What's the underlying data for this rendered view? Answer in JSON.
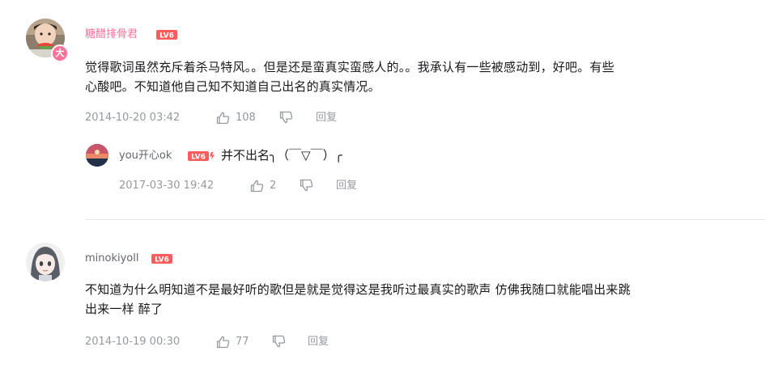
{
  "comments": [
    {
      "username": "糖醋排骨君",
      "level": "LV6",
      "avatar_badge": "大",
      "text_line1": "觉得歌词虽然充斥着杀马特风。。但是还是蛮真实蛮感人的。。我承认有一些被感动到，好吧。有些",
      "text_line2": "心酸吧。不知道他自己知不知道自己出名的真实情况。",
      "time": "2014-10-20 03:42",
      "likes": "108",
      "reply_label": "回复",
      "replies": [
        {
          "username": "you开心ok",
          "level": "LV6",
          "text": "并不出名╮（￣▽￣）╭",
          "time": "2017-03-30 19:42",
          "likes": "2",
          "reply_label": "回复"
        }
      ]
    },
    {
      "username": "minokiyoll",
      "level": "LV6",
      "text_line1": "不知道为什么明知道不是最好听的歌但是就是觉得这是我听过最真实的歌声 仿佛我随口就能唱出来跳",
      "text_line2": "出来一样 醉了",
      "time": "2014-10-19 00:30",
      "likes": "77",
      "reply_label": "回复"
    }
  ],
  "colors": {
    "vip_name": "#fb7299",
    "normal_name": "#61666d",
    "meta": "#9499a0",
    "level_badge": "#ff5d5d",
    "divider": "#e3e5e7"
  },
  "icons": {
    "like": "thumbs-up-icon",
    "dislike": "thumbs-down-icon",
    "level": "level-badge-icon"
  }
}
